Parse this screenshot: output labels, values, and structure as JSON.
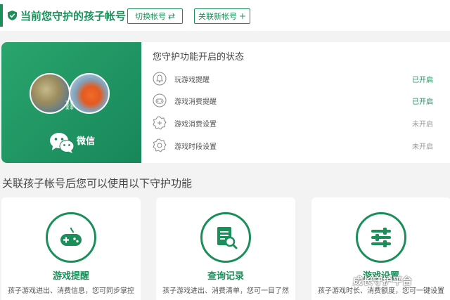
{
  "header": {
    "current_label": "当前您守护的孩子帐号",
    "switch_button": "切换帐号",
    "switch_icon": "⇄",
    "link_button": "关联新帐号",
    "link_icon": "+"
  },
  "account": {
    "platform": "微信"
  },
  "status": {
    "title": "您守护功能开启的状态",
    "items": [
      {
        "label": "玩游戏提醒",
        "value": "已开启",
        "icon": "bell-icon"
      },
      {
        "label": "游戏消费提醒",
        "value": "已开启",
        "icon": "gamepad-bell-icon"
      },
      {
        "label": "游戏消费设置",
        "value": "未开启",
        "icon": "gear-badge-icon"
      },
      {
        "label": "游戏时段设置",
        "value": "未开启",
        "icon": "clock-gear-icon"
      }
    ]
  },
  "features": {
    "heading": "关联孩子帐号后您可以使用以下守护功能",
    "cards": [
      {
        "title": "游戏提醒",
        "desc": "孩子游戏进出、消费信息，您可同步掌控",
        "icon": "gamepad-icon"
      },
      {
        "title": "查询记录",
        "desc": "孩子游戏进出、消费清单，您可一目了然",
        "icon": "document-search-icon"
      },
      {
        "title": "游戏设置",
        "desc": "孩子游戏时长、消费额度，您可一键设置",
        "icon": "sliders-icon"
      }
    ]
  },
  "watermark": {
    "text": "成长守护平台"
  },
  "colors": {
    "accent": "#1b8f5a",
    "enabled": "#1b8f5a",
    "disabled": "#999999"
  }
}
